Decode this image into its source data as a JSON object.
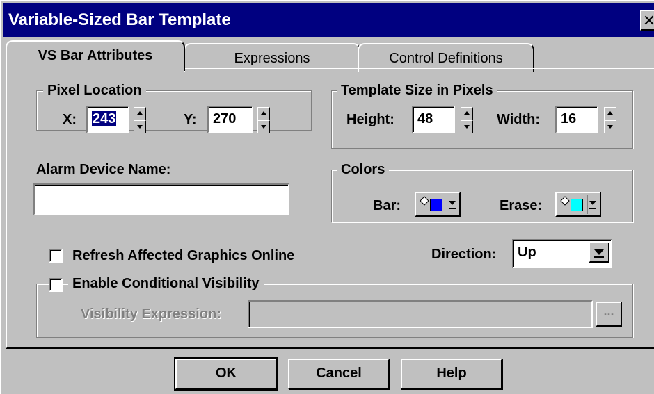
{
  "window": {
    "title": "Variable-Sized Bar Template",
    "close_glyph": "✕"
  },
  "tabs": [
    {
      "label": "VS Bar Attributes",
      "active": true
    },
    {
      "label": "Expressions",
      "active": false
    },
    {
      "label": "Control Definitions",
      "active": false
    }
  ],
  "pixel_location": {
    "legend": "Pixel Location",
    "x_label": "X:",
    "x_value": "243",
    "y_label": "Y:",
    "y_value": "270"
  },
  "template_size": {
    "legend": "Template Size in Pixels",
    "height_label": "Height:",
    "height_value": "48",
    "width_label": "Width:",
    "width_value": "16"
  },
  "alarm": {
    "label": "Alarm Device Name:",
    "value": ""
  },
  "colors": {
    "legend": "Colors",
    "bar_label": "Bar:",
    "bar_color": "#0000ff",
    "erase_label": "Erase:",
    "erase_color": "#00ffff"
  },
  "refresh": {
    "label": "Refresh Affected Graphics Online",
    "checked": false
  },
  "direction": {
    "label": "Direction:",
    "value": "Up"
  },
  "visibility": {
    "label": "Enable Conditional Visibility",
    "checked": false,
    "expr_label": "Visibility Expression:",
    "expr_value": "",
    "browse_label": "..."
  },
  "buttons": {
    "ok": "OK",
    "cancel": "Cancel",
    "help": "Help"
  },
  "icons": {
    "close": "close-icon",
    "paint_bucket": "paint-bucket-icon",
    "spin": "spin-arrows-icon",
    "dropdown": "chevron-down-icon"
  }
}
